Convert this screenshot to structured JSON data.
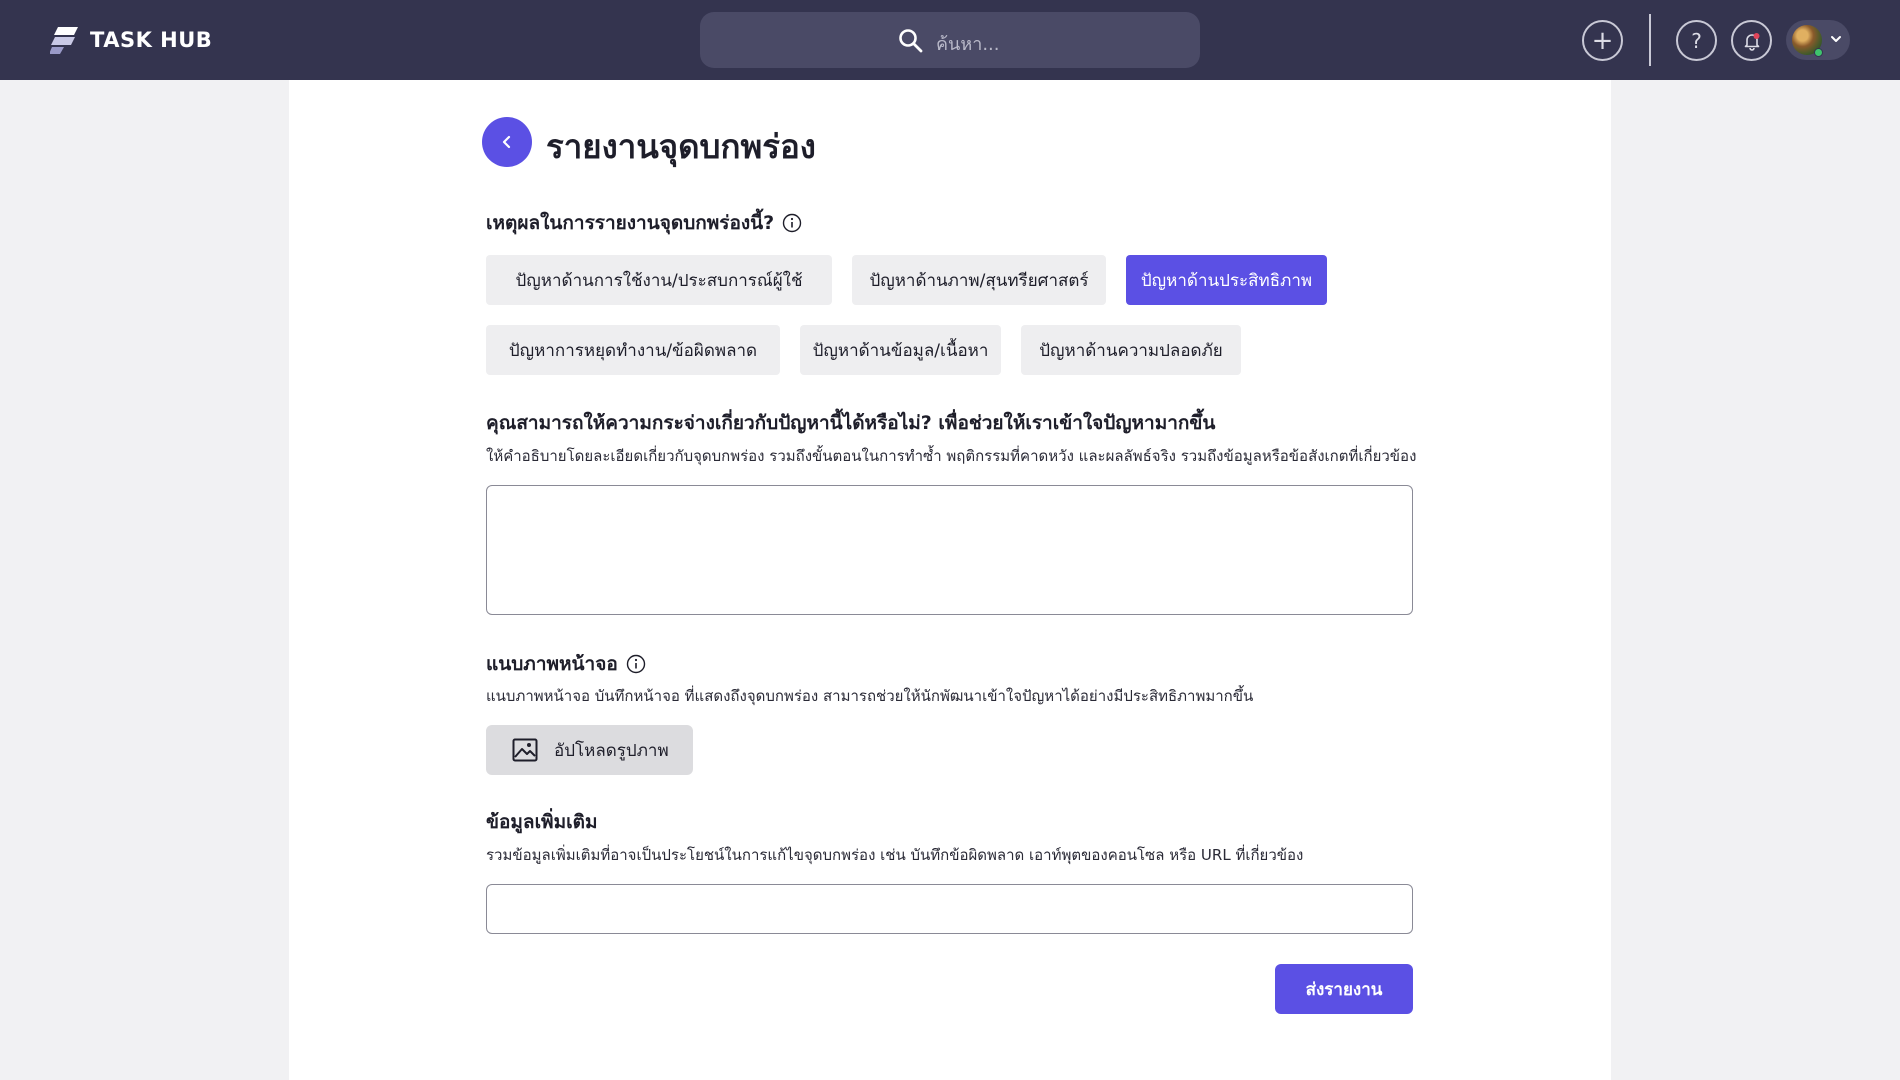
{
  "app": {
    "name": "TASK HUB"
  },
  "search": {
    "placeholder": "ค้นหา..."
  },
  "header_actions": {
    "plus": "+",
    "help": "?"
  },
  "page": {
    "title": "รายงานจุดบกพร่อง"
  },
  "reason": {
    "label": "เหตุผลในการรายงานจุดบกพร่องนี้?",
    "options": [
      "ปัญหาด้านการใช้งาน/ประสบการณ์ผู้ใช้",
      "ปัญหาด้านภาพ/สุนทรียศาสตร์",
      "ปัญหาด้านประสิทธิภาพ",
      "ปัญหาการหยุดทำงาน/ข้อผิดพลาด",
      "ปัญหาด้านข้อมูล/เนื้อหา",
      "ปัญหาด้านความปลอดภัย"
    ],
    "selected": "ปัญหาด้านประสิทธิภาพ"
  },
  "description": {
    "label": "คุณสามารถให้ความกระจ่างเกี่ยวกับปัญหานี้ได้หรือไม่? เพื่อช่วยให้เราเข้าใจปัญหามากขึ้น",
    "sub": "ให้คำอธิบายโดยละเอียดเกี่ยวกับจุดบกพร่อง รวมถึงขั้นตอนในการทำซ้ำ พฤติกรรมที่คาดหวัง และผลลัพธ์จริง รวมถึงข้อมูลหรือข้อสังเกตที่เกี่ยวข้อง",
    "value": ""
  },
  "screenshot": {
    "label": "แนบภาพหน้าจอ",
    "sub": "แนบภาพหน้าจอ บันทึกหน้าจอ ที่แสดงถึงจุดบกพร่อง สามารถช่วยให้นักพัฒนาเข้าใจปัญหาได้อย่างมีประสิทธิภาพมากขึ้น",
    "upload_label": "อัปโหลดรูปภาพ"
  },
  "additional": {
    "label": "ข้อมูลเพิ่มเติม",
    "sub": "รวมข้อมูลเพิ่มเติมที่อาจเป็นประโยชน์ในการแก้ไขจุดบกพร่อง เช่น บันทึกข้อผิดพลาด เอาท์พุตของคอนโซล หรือ URL ที่เกี่ยวข้อง",
    "value": ""
  },
  "submit": {
    "label": "ส่งรายงาน"
  },
  "colors": {
    "topbar": "#34344f",
    "accent": "#5b50e4",
    "chip": "#eeeef0"
  }
}
